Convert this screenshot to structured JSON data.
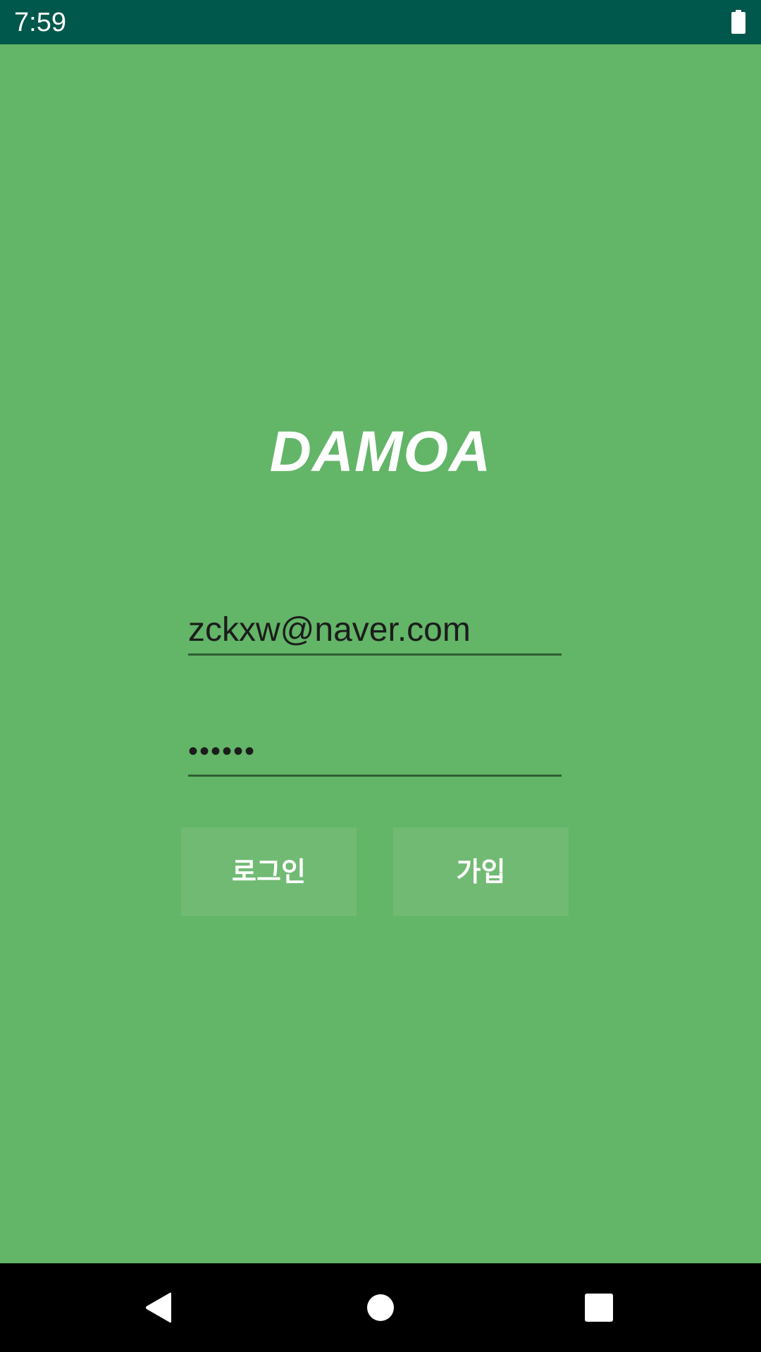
{
  "status_bar": {
    "time": "7:59",
    "battery_icon": "battery-full-icon",
    "background": "#00574b"
  },
  "app": {
    "title": "DAMOA",
    "background": "#63b567"
  },
  "login_form": {
    "email_value": "zckxw@naver.com",
    "password_value": "••••••",
    "login_button_label": "로그인",
    "join_button_label": "가입"
  },
  "nav_bar": {
    "back_icon": "back-triangle-icon",
    "home_icon": "home-circle-icon",
    "recents_icon": "recents-square-icon"
  }
}
